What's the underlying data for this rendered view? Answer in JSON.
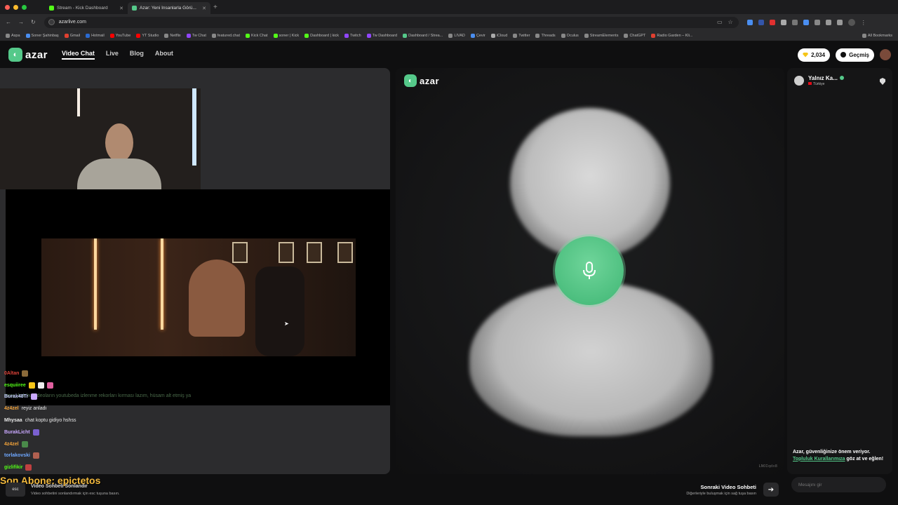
{
  "browser": {
    "tabs": [
      {
        "title": "Stream - Kick Dashboard",
        "icon_color": "#53fc18",
        "active": false
      },
      {
        "title": "Azar: Yeni İnsanlarla Görü...",
        "icon_color": "#55c98a",
        "active": true
      }
    ],
    "url": "azarlive.com",
    "bookmarks": [
      "Aspa",
      "Soner Şahinbaş",
      "Gmail",
      "Hotmail",
      "YouTube",
      "YT Studio",
      "Netflix",
      "Tw Chat",
      "featured.chat",
      "Kick Chat",
      "soner | Kick",
      "Dashboard | kick",
      "Twitch",
      "Tw Dashboard",
      "Dashboard / Strea...",
      "LIVAD",
      "Çevir",
      "iCloud",
      "Twitter",
      "Threads",
      "Oculus",
      "StreamElements",
      "ChatGPT",
      "Radio Garden – Kli..."
    ],
    "all_bookmarks": "All Bookmarks"
  },
  "header": {
    "logo_text": "azar",
    "nav": [
      "Video Chat",
      "Live",
      "Blog",
      "About"
    ],
    "gems": "2,034",
    "history_label": "Geçmiş"
  },
  "overlay": {
    "faded_chat": "forza_ksk bu videoların youtubeda izlenme rekorları kırması lazım, hüsam alt etmiş ya",
    "chat": [
      {
        "user": "0Altan",
        "text": "",
        "color": "#e0443a"
      },
      {
        "user": "esquiiree",
        "text": "",
        "color": "#53fc18"
      },
      {
        "user": "Burak48Tr",
        "text": "",
        "color": "#c8d0ff"
      },
      {
        "user": "4z4zel",
        "text": "reyiz anladı",
        "color": "#f2a33a"
      },
      {
        "user": "Mhysaa",
        "text": "chat koptu gidiyo hshss",
        "color": "#e8e8e8"
      },
      {
        "user": "BurakLicht",
        "text": "",
        "color": "#c9a8ff"
      },
      {
        "user": "4z4zel",
        "text": "",
        "color": "#f2a33a"
      },
      {
        "user": "torlakovski",
        "text": "",
        "color": "#6fa8ff"
      },
      {
        "user": "gizlifikir",
        "text": "",
        "color": "#53fc18"
      }
    ],
    "sub_banner": "Son Abone: epictetos"
  },
  "controls": {
    "esc_key": "esc",
    "esc_title": "Video Sohbeti Sonlandır",
    "esc_sub": "Video sohbetini sonlandırmak için esc tuşuna basın.",
    "next_title": "Sonraki Video Sohbeti",
    "next_sub": "Diğerleriyle buluşmak için sağ tuşa basın"
  },
  "stage": {
    "logo_text": "azar",
    "session_id": "LNOIqdx8"
  },
  "sidebar": {
    "peer_name": "Yalnız Ka...",
    "peer_country": "Türkiye",
    "safety_text": "Azar, güvenliğinize önem veriyor.",
    "safety_link": "Topluluk Kurallarımıza",
    "safety_suffix": "göz at ve eğlen!",
    "message_placeholder": "Mesajını gir"
  }
}
